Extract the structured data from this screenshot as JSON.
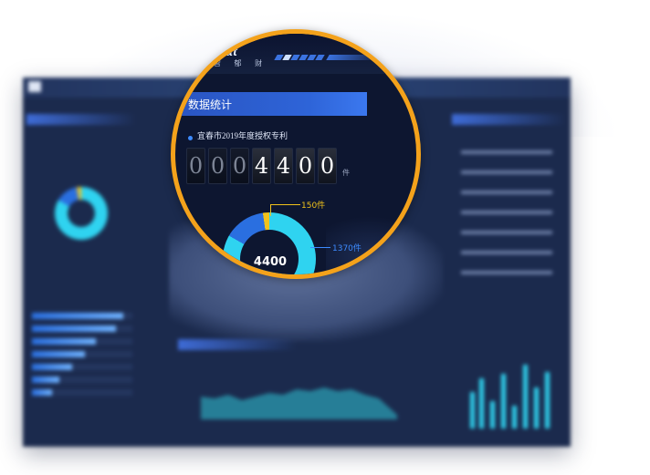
{
  "app": {
    "brand_title": "oPat",
    "brand_sub": "智 郁 财"
  },
  "stats_panel": {
    "header": "数据统计",
    "subtitle": "宜春市2019年度授权专利",
    "digits": [
      "0",
      "0",
      "0",
      "4",
      "4",
      "0",
      "0"
    ],
    "lit_from_index": 3,
    "unit": "件"
  },
  "donut": {
    "total_label": "4400",
    "annotations": {
      "yellow": "150件",
      "blue": "1370件"
    },
    "colors": {
      "main": "#2fd3f0",
      "secondary": "#2a6fe0",
      "accent": "#f1c21b"
    }
  },
  "colors": {
    "ring": "#f4a21b",
    "background": "#0d1630",
    "section_header": "#2e64d8"
  }
}
